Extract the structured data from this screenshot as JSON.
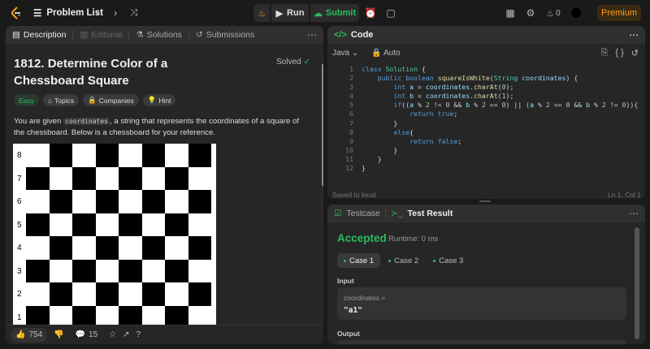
{
  "topbar": {
    "problem_list": "Problem List",
    "run": "Run",
    "submit": "Submit",
    "streak": "0",
    "premium": "Premium"
  },
  "left_tabs": [
    "Description",
    "Editorial",
    "Solutions",
    "Submissions"
  ],
  "problem": {
    "title": "1812. Determine Color of a Chessboard Square",
    "status": "Solved",
    "tags": [
      "Easy",
      "Topics",
      "Companies",
      "Hint"
    ],
    "desc_1": "You are given ",
    "desc_code": "coordinates",
    "desc_2": ", a string that represents the coordinates of a square of the chessboard. Below is a chessboard for your reference."
  },
  "board_ranks": [
    "8",
    "7",
    "6",
    "5",
    "4",
    "3",
    "2",
    "1"
  ],
  "bottom_bar": {
    "likes": "754",
    "comments": "15"
  },
  "code": {
    "title": "Code",
    "language": "Java",
    "mode": "Auto",
    "saved": "Saved to local",
    "cursor": "Ln 1, Col 1"
  },
  "result": {
    "tab_testcase": "Testcase",
    "tab_result": "Test Result",
    "status": "Accepted",
    "runtime": "Runtime: 0 ms",
    "cases": [
      "Case 1",
      "Case 2",
      "Case 3"
    ],
    "input_label": "Input",
    "input_name": "coordinates =",
    "input_value": "\"a1\"",
    "output_label": "Output"
  },
  "colors": {
    "accent": "#ffa116",
    "green": "#2cbb5d",
    "panel": "#262626"
  }
}
